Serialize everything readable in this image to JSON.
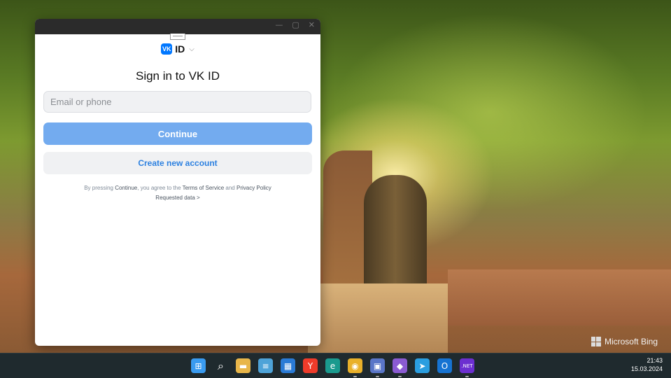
{
  "window": {
    "controls": {
      "minimize": "—",
      "maximize": "▢",
      "close": "✕"
    }
  },
  "brand": {
    "badge": "VK",
    "id_text": "ID",
    "chevron": "⌵"
  },
  "heading": "Sign in to VK ID",
  "login": {
    "placeholder": "Email or phone",
    "value": ""
  },
  "buttons": {
    "continue": "Continue",
    "create_account": "Create new account"
  },
  "legal": {
    "prefix": "By pressing ",
    "continue_word": "Continue",
    "middle": ", you agree to the ",
    "terms": "Terms of Service",
    "and": " and ",
    "privacy": "Privacy Policy",
    "requested": "Requested data >"
  },
  "desktop": {
    "watermark": "Microsoft Bing"
  },
  "taskbar": {
    "apps": [
      {
        "name": "start-icon",
        "glyph": "⊞",
        "color": "#3a9bf0"
      },
      {
        "name": "search-icon",
        "glyph": "⌕",
        "color": "transparent"
      },
      {
        "name": "file-explorer-icon",
        "glyph": "▬",
        "color": "#e8b64a"
      },
      {
        "name": "notepad-icon",
        "glyph": "≡",
        "color": "#4ea3d8"
      },
      {
        "name": "store-icon",
        "glyph": "▦",
        "color": "#2a7bd6"
      },
      {
        "name": "yandex-browser-icon",
        "glyph": "Y",
        "color": "#ee3b2a"
      },
      {
        "name": "edge-icon",
        "glyph": "e",
        "color": "#1a9a8e"
      },
      {
        "name": "chrome-icon",
        "glyph": "◉",
        "color": "#e9b12a"
      },
      {
        "name": "save-disk-icon",
        "glyph": "▣",
        "color": "#5a76c8"
      },
      {
        "name": "visual-studio-icon",
        "glyph": "◆",
        "color": "#8a5bd2"
      },
      {
        "name": "telegram-icon",
        "glyph": "➤",
        "color": "#2a9ee0"
      },
      {
        "name": "outlook-icon",
        "glyph": "O",
        "color": "#1673d2"
      },
      {
        "name": "dotnet-icon",
        "glyph": ".NET",
        "color": "#6c2fd0"
      }
    ],
    "time": "21:43",
    "date": "15.03.2024"
  }
}
